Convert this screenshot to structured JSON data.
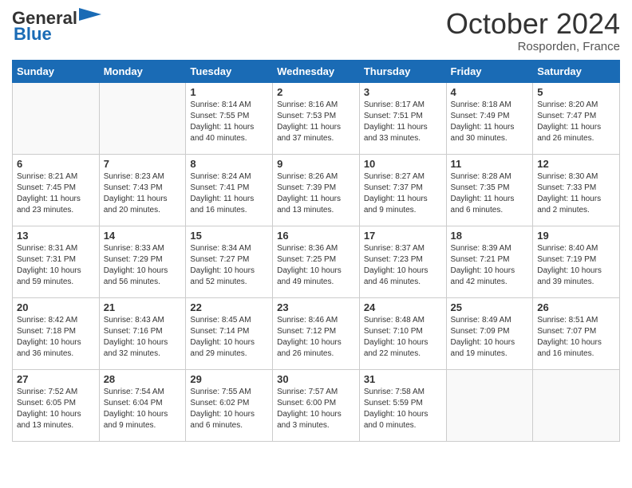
{
  "logo": {
    "line1": "General",
    "line2": "Blue"
  },
  "header": {
    "month": "October 2024",
    "location": "Rosporden, France"
  },
  "weekdays": [
    "Sunday",
    "Monday",
    "Tuesday",
    "Wednesday",
    "Thursday",
    "Friday",
    "Saturday"
  ],
  "weeks": [
    [
      {
        "day": "",
        "info": ""
      },
      {
        "day": "",
        "info": ""
      },
      {
        "day": "1",
        "info": "Sunrise: 8:14 AM\nSunset: 7:55 PM\nDaylight: 11 hours\nand 40 minutes."
      },
      {
        "day": "2",
        "info": "Sunrise: 8:16 AM\nSunset: 7:53 PM\nDaylight: 11 hours\nand 37 minutes."
      },
      {
        "day": "3",
        "info": "Sunrise: 8:17 AM\nSunset: 7:51 PM\nDaylight: 11 hours\nand 33 minutes."
      },
      {
        "day": "4",
        "info": "Sunrise: 8:18 AM\nSunset: 7:49 PM\nDaylight: 11 hours\nand 30 minutes."
      },
      {
        "day": "5",
        "info": "Sunrise: 8:20 AM\nSunset: 7:47 PM\nDaylight: 11 hours\nand 26 minutes."
      }
    ],
    [
      {
        "day": "6",
        "info": "Sunrise: 8:21 AM\nSunset: 7:45 PM\nDaylight: 11 hours\nand 23 minutes."
      },
      {
        "day": "7",
        "info": "Sunrise: 8:23 AM\nSunset: 7:43 PM\nDaylight: 11 hours\nand 20 minutes."
      },
      {
        "day": "8",
        "info": "Sunrise: 8:24 AM\nSunset: 7:41 PM\nDaylight: 11 hours\nand 16 minutes."
      },
      {
        "day": "9",
        "info": "Sunrise: 8:26 AM\nSunset: 7:39 PM\nDaylight: 11 hours\nand 13 minutes."
      },
      {
        "day": "10",
        "info": "Sunrise: 8:27 AM\nSunset: 7:37 PM\nDaylight: 11 hours\nand 9 minutes."
      },
      {
        "day": "11",
        "info": "Sunrise: 8:28 AM\nSunset: 7:35 PM\nDaylight: 11 hours\nand 6 minutes."
      },
      {
        "day": "12",
        "info": "Sunrise: 8:30 AM\nSunset: 7:33 PM\nDaylight: 11 hours\nand 2 minutes."
      }
    ],
    [
      {
        "day": "13",
        "info": "Sunrise: 8:31 AM\nSunset: 7:31 PM\nDaylight: 10 hours\nand 59 minutes."
      },
      {
        "day": "14",
        "info": "Sunrise: 8:33 AM\nSunset: 7:29 PM\nDaylight: 10 hours\nand 56 minutes."
      },
      {
        "day": "15",
        "info": "Sunrise: 8:34 AM\nSunset: 7:27 PM\nDaylight: 10 hours\nand 52 minutes."
      },
      {
        "day": "16",
        "info": "Sunrise: 8:36 AM\nSunset: 7:25 PM\nDaylight: 10 hours\nand 49 minutes."
      },
      {
        "day": "17",
        "info": "Sunrise: 8:37 AM\nSunset: 7:23 PM\nDaylight: 10 hours\nand 46 minutes."
      },
      {
        "day": "18",
        "info": "Sunrise: 8:39 AM\nSunset: 7:21 PM\nDaylight: 10 hours\nand 42 minutes."
      },
      {
        "day": "19",
        "info": "Sunrise: 8:40 AM\nSunset: 7:19 PM\nDaylight: 10 hours\nand 39 minutes."
      }
    ],
    [
      {
        "day": "20",
        "info": "Sunrise: 8:42 AM\nSunset: 7:18 PM\nDaylight: 10 hours\nand 36 minutes."
      },
      {
        "day": "21",
        "info": "Sunrise: 8:43 AM\nSunset: 7:16 PM\nDaylight: 10 hours\nand 32 minutes."
      },
      {
        "day": "22",
        "info": "Sunrise: 8:45 AM\nSunset: 7:14 PM\nDaylight: 10 hours\nand 29 minutes."
      },
      {
        "day": "23",
        "info": "Sunrise: 8:46 AM\nSunset: 7:12 PM\nDaylight: 10 hours\nand 26 minutes."
      },
      {
        "day": "24",
        "info": "Sunrise: 8:48 AM\nSunset: 7:10 PM\nDaylight: 10 hours\nand 22 minutes."
      },
      {
        "day": "25",
        "info": "Sunrise: 8:49 AM\nSunset: 7:09 PM\nDaylight: 10 hours\nand 19 minutes."
      },
      {
        "day": "26",
        "info": "Sunrise: 8:51 AM\nSunset: 7:07 PM\nDaylight: 10 hours\nand 16 minutes."
      }
    ],
    [
      {
        "day": "27",
        "info": "Sunrise: 7:52 AM\nSunset: 6:05 PM\nDaylight: 10 hours\nand 13 minutes."
      },
      {
        "day": "28",
        "info": "Sunrise: 7:54 AM\nSunset: 6:04 PM\nDaylight: 10 hours\nand 9 minutes."
      },
      {
        "day": "29",
        "info": "Sunrise: 7:55 AM\nSunset: 6:02 PM\nDaylight: 10 hours\nand 6 minutes."
      },
      {
        "day": "30",
        "info": "Sunrise: 7:57 AM\nSunset: 6:00 PM\nDaylight: 10 hours\nand 3 minutes."
      },
      {
        "day": "31",
        "info": "Sunrise: 7:58 AM\nSunset: 5:59 PM\nDaylight: 10 hours\nand 0 minutes."
      },
      {
        "day": "",
        "info": ""
      },
      {
        "day": "",
        "info": ""
      }
    ]
  ]
}
